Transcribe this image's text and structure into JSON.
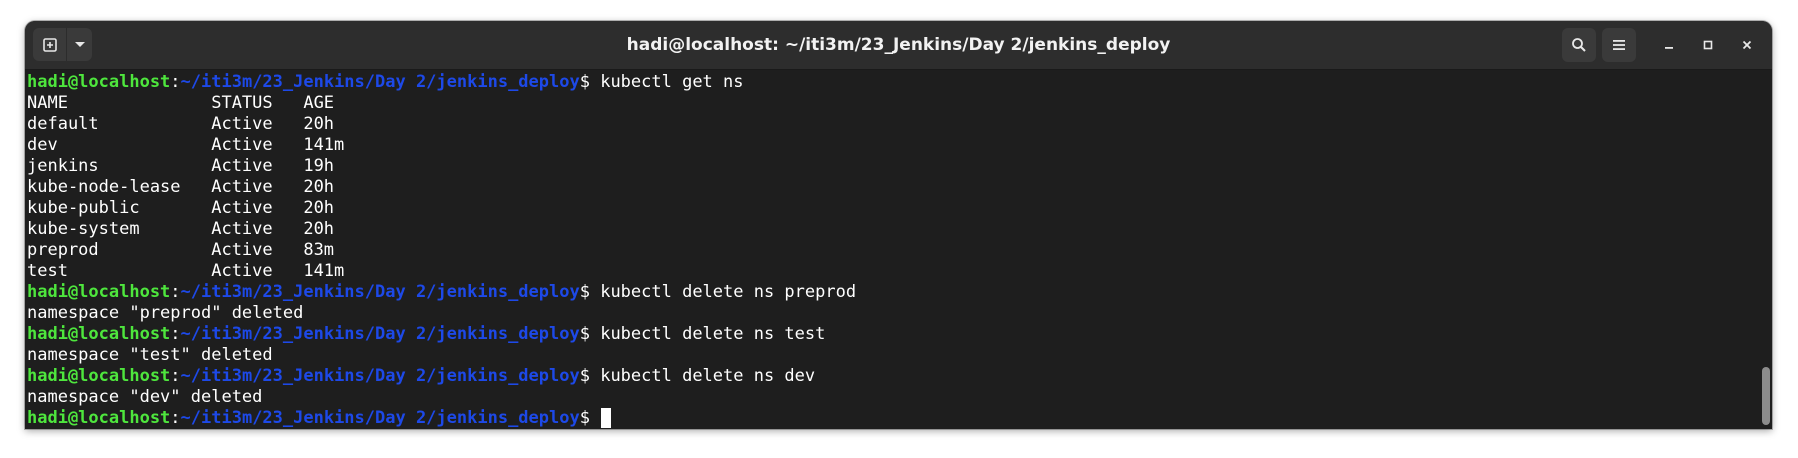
{
  "window": {
    "title": "hadi@localhost: ~/iti3m/23_Jenkins/Day 2/jenkins_deploy"
  },
  "icons": {
    "new_tab": "new-tab-icon",
    "tab_menu": "chevron-down-icon",
    "search": "search-icon",
    "menu": "hamburger-menu-icon",
    "minimize": "minimize-icon",
    "maximize": "maximize-icon",
    "close": "close-icon"
  },
  "prompt": {
    "user_host": "hadi@localhost",
    "separator": ":",
    "path": "~/iti3m/23_Jenkins/Day 2/jenkins_deploy",
    "symbol": "$ "
  },
  "terminal": {
    "cmd1": "kubectl get ns",
    "table_header": "NAME              STATUS   AGE",
    "ns_rows": [
      "default           Active   20h",
      "dev               Active   141m",
      "jenkins           Active   19h",
      "kube-node-lease   Active   20h",
      "kube-public       Active   20h",
      "kube-system       Active   20h",
      "preprod           Active   83m",
      "test              Active   141m"
    ],
    "cmd2": "kubectl delete ns preprod",
    "out2": "namespace \"preprod\" deleted",
    "cmd3": "kubectl delete ns test",
    "out3": "namespace \"test\" deleted",
    "cmd4": "kubectl delete ns dev",
    "out4": "namespace \"dev\" deleted",
    "cmd5": ""
  },
  "colors": {
    "prompt_user": "#4ee63d",
    "prompt_path": "#1d49e8",
    "background": "#1e1e1e",
    "headerbar": "#2d2d2d"
  }
}
